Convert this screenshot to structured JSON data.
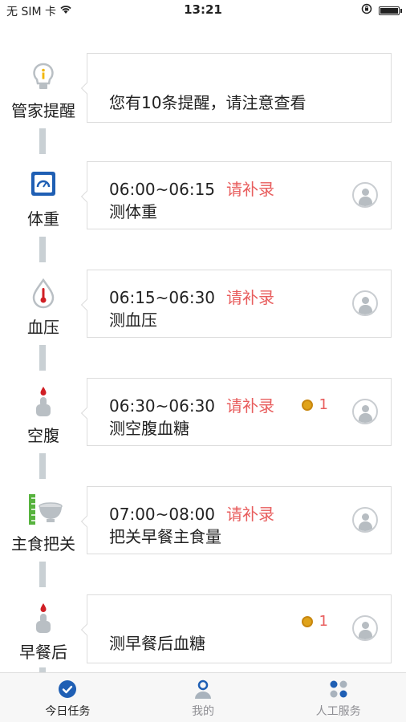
{
  "status_bar": {
    "carrier": "无 SIM 卡",
    "time": "13:21"
  },
  "categories": [
    {
      "label": "管家提醒",
      "icon": "bulb-icon"
    },
    {
      "label": "体重",
      "icon": "scale-icon"
    },
    {
      "label": "血压",
      "icon": "thermometer-drop-icon"
    },
    {
      "label": "空腹",
      "icon": "finger-blood-icon"
    },
    {
      "label": "主食把关",
      "icon": "bowl-ruler-icon"
    },
    {
      "label": "早餐后",
      "icon": "finger-blood-icon"
    }
  ],
  "cards": [
    {
      "reminder": "您有10条提醒，请注意查看"
    },
    {
      "time": "06:00~06:15",
      "status": "请补录",
      "task": "测体重"
    },
    {
      "time": "06:15~06:30",
      "status": "请补录",
      "task": "测血压"
    },
    {
      "time": "06:30~06:30",
      "status": "请补录",
      "task": "测空腹血糖",
      "coins": "1"
    },
    {
      "time": "07:00~08:00",
      "status": "请补录",
      "task": "把关早餐主食量"
    },
    {
      "task": "测早餐后血糖",
      "coins": "1"
    }
  ],
  "tabs": [
    {
      "label": "今日任务",
      "icon": "check-circle-icon",
      "active": true
    },
    {
      "label": "我的",
      "icon": "person-icon",
      "active": false
    },
    {
      "label": "人工服务",
      "icon": "grid-icon",
      "active": false
    }
  ],
  "colors": {
    "accent": "#1f5fb4",
    "alert": "#e85d5d",
    "timeline": "#c9d0d4",
    "coin": "#e0a31a"
  }
}
